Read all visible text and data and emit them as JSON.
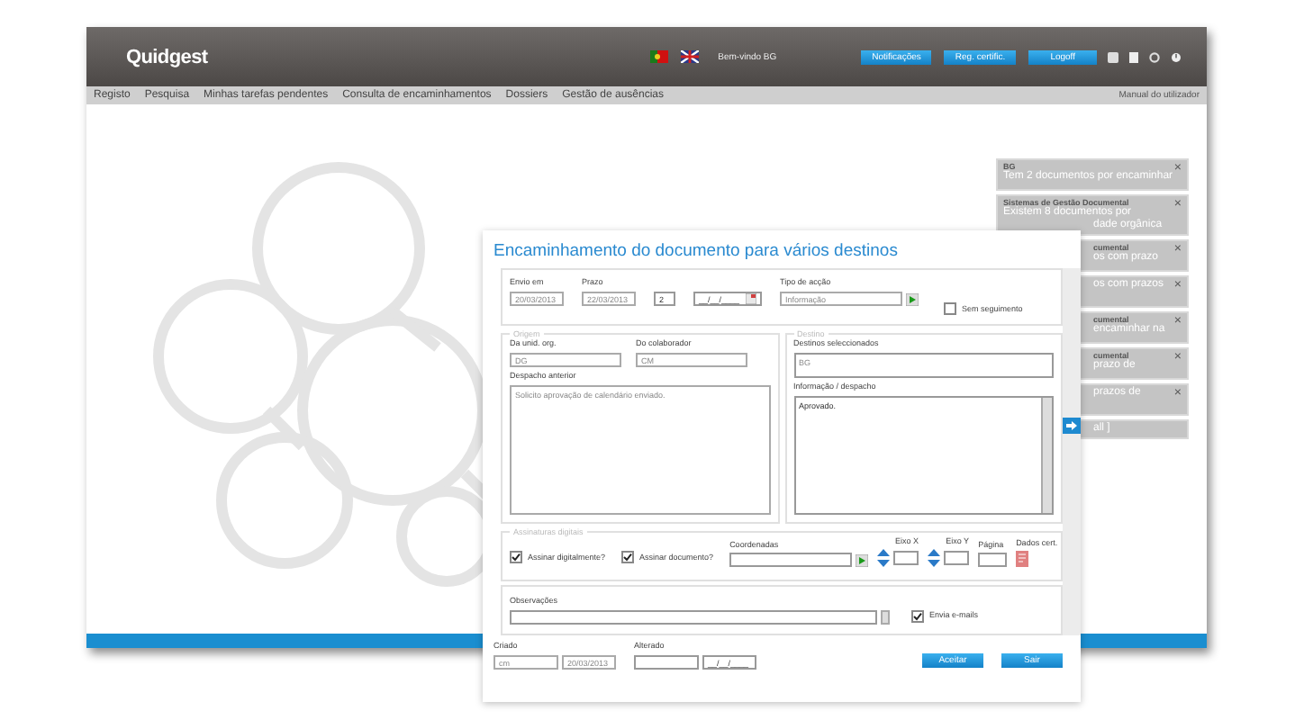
{
  "header": {
    "logo": "Quidgest",
    "welcome": "Bem-vindo BG",
    "buttons": [
      "Notificações",
      "Reg. certific.",
      "Logoff"
    ]
  },
  "nav": {
    "items": [
      "Registo",
      "Pesquisa",
      "Minhas tarefas pendentes",
      "Consulta de encaminhamentos",
      "Dossiers",
      "Gestão de ausências"
    ],
    "manual": "Manual do utilizador"
  },
  "notifications": [
    {
      "title": {
        "text": "BG"
      },
      "lines": [
        {
          "text": "Tem 2 documentos por encaminhar",
          "cut": false
        }
      ],
      "close": "×"
    },
    {
      "title": {
        "text": "Sistemas de Gestão Documental"
      },
      "lines": [
        {
          "text": "Existem 8 documentos por",
          "cut": false
        },
        {
          "text": "dade orgânica",
          "cut": true
        }
      ],
      "close": "×"
    },
    {
      "title": {
        "text": "cumental",
        "cut": true
      },
      "lines": [
        {
          "text": "os com prazo",
          "cut": true
        }
      ],
      "close": "×"
    },
    {
      "lines": [
        {
          "text": "os com prazos",
          "cut": true
        }
      ],
      "close": "×"
    },
    {
      "title": {
        "text": "cumental",
        "cut": true
      },
      "lines": [
        {
          "text": "encaminhar na",
          "cut": true
        }
      ],
      "close": "×"
    },
    {
      "title": {
        "text": "cumental",
        "cut": true
      },
      "lines": [
        {
          "text": "prazo de",
          "cut": true
        }
      ],
      "close": "×"
    },
    {
      "lines": [
        {
          "text": "prazos de",
          "cut": true
        }
      ],
      "close": "×"
    },
    {
      "lines": [
        {
          "text": "all ]",
          "cut": true
        }
      ]
    }
  ],
  "dialog": {
    "title": "Encaminhamento do documento para vários destinos",
    "top_row": [
      {
        "kind": "date",
        "label": "Envio em",
        "value": "20/03/2013",
        "disabled": true
      },
      {
        "kind": "date",
        "label": "Prazo",
        "value": "22/03/2013",
        "disabled": true
      },
      {
        "kind": "number",
        "value": "2",
        "disabled": false
      },
      {
        "kind": "datepicker",
        "value": "__/__/____",
        "disabled": false
      },
      {
        "kind": "select",
        "label": "Tipo de acção",
        "value": "Informação",
        "disabled": true
      },
      {
        "kind": "checkbox",
        "label": "Sem seguimento",
        "checked": false
      }
    ],
    "origem": {
      "legend": "Origem",
      "unit_label": "Da unid. org.",
      "unit": "DG",
      "collab_label": "Do colaborador",
      "collab": "CM",
      "despacho_label": "Despacho anterior",
      "despacho": "Solicito aprovação de calendário enviado."
    },
    "destino": {
      "legend": "Destino",
      "selected_label": "Destinos seleccionados",
      "selected": "BG",
      "info_label": "Informação / despacho",
      "info": "Aprovado."
    },
    "signatures": {
      "legend": "Assinaturas digitais",
      "items": [
        {
          "kind": "checkbox",
          "label": "Assinar digitalmente?",
          "checked": true
        },
        {
          "kind": "checkbox",
          "label": "Assinar documento?",
          "checked": true
        },
        {
          "kind": "lookup",
          "label": "Coordenadas"
        },
        {
          "kind": "spinner",
          "label": "Eixo X"
        },
        {
          "kind": "spinner",
          "label": "Eixo Y"
        },
        {
          "kind": "input",
          "label": "Página"
        },
        {
          "kind": "cert",
          "label": "Dados cert."
        }
      ]
    },
    "observacoes": {
      "label": "Observações",
      "email_label": "Envia e-mails",
      "email_checked": true
    },
    "criado": {
      "label": "Criado",
      "user": "cm",
      "date": "20/03/2013"
    },
    "alterado": {
      "label": "Alterado",
      "date": "__/__/____"
    },
    "buttons": [
      "Aceitar",
      "Sair"
    ]
  }
}
